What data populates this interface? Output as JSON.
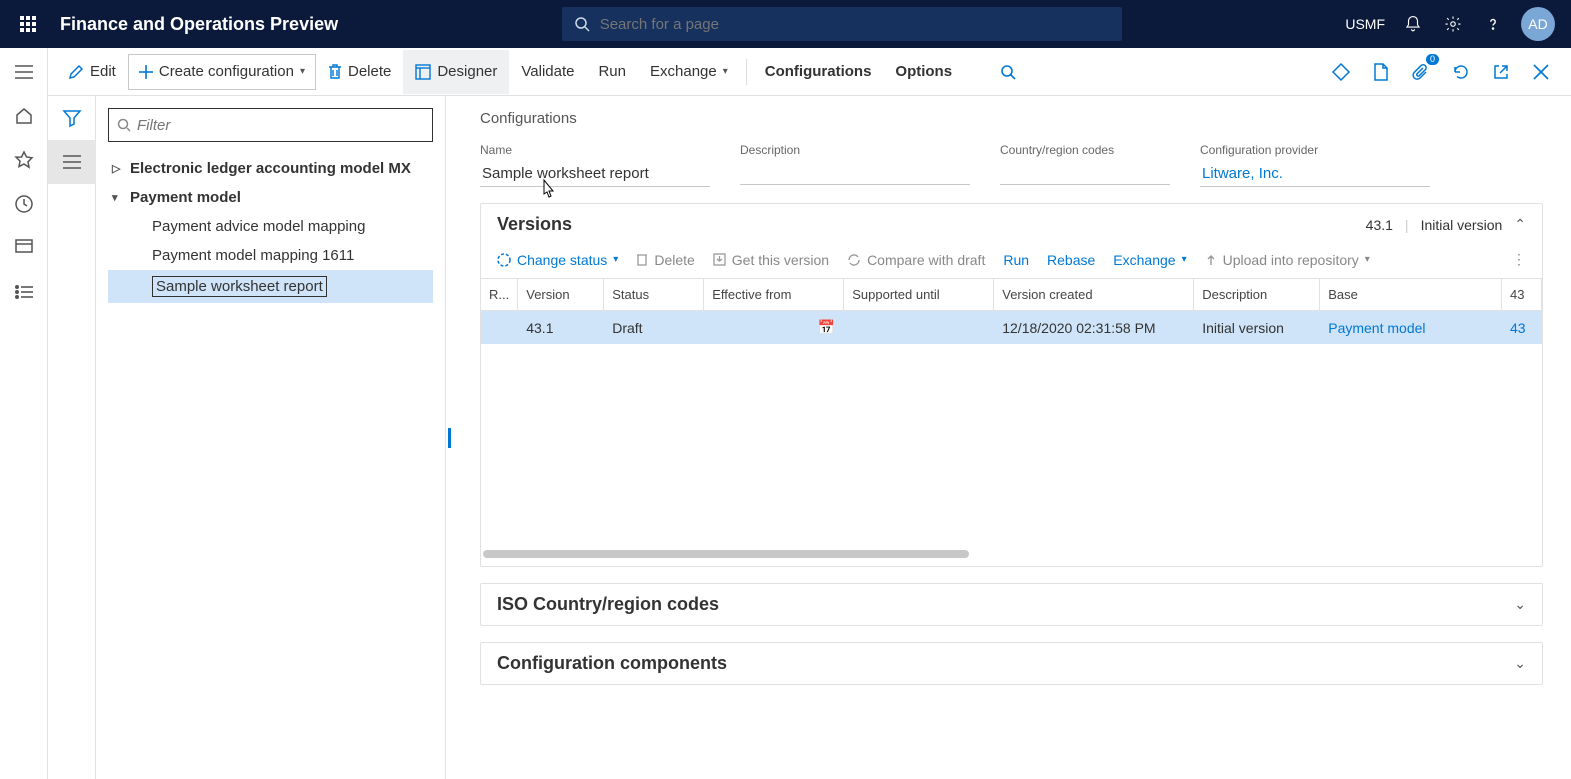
{
  "header": {
    "app_title": "Finance and Operations Preview",
    "search_placeholder": "Search for a page",
    "company": "USMF",
    "avatar_initials": "AD"
  },
  "actionbar": {
    "edit": "Edit",
    "create": "Create configuration",
    "delete": "Delete",
    "designer": "Designer",
    "validate": "Validate",
    "run": "Run",
    "exchange": "Exchange",
    "configurations": "Configurations",
    "options": "Options",
    "attachments_badge": "0"
  },
  "tree": {
    "filter_placeholder": "Filter",
    "items": [
      {
        "label": "Electronic ledger accounting model MX"
      },
      {
        "label": "Payment model"
      },
      {
        "label": "Payment advice model mapping"
      },
      {
        "label": "Payment model mapping 1611"
      },
      {
        "label": "Sample worksheet report"
      }
    ]
  },
  "details": {
    "breadcrumb": "Configurations",
    "fields": {
      "name_label": "Name",
      "name_value": "Sample worksheet report",
      "description_label": "Description",
      "description_value": "",
      "country_label": "Country/region codes",
      "country_value": "",
      "provider_label": "Configuration provider",
      "provider_value": "Litware, Inc."
    },
    "versions": {
      "title": "Versions",
      "meta_version": "43.1",
      "meta_desc": "Initial version",
      "toolbar": {
        "change_status": "Change status",
        "delete": "Delete",
        "get_version": "Get this version",
        "compare": "Compare with draft",
        "run": "Run",
        "rebase": "Rebase",
        "exchange": "Exchange",
        "upload": "Upload into repository"
      },
      "columns": {
        "r": "R...",
        "version": "Version",
        "status": "Status",
        "effective": "Effective from",
        "supported": "Supported until",
        "created": "Version created",
        "description": "Description",
        "base": "Base",
        "basever": "43"
      },
      "row": {
        "version": "43.1",
        "status": "Draft",
        "effective": "",
        "supported": "",
        "created": "12/18/2020 02:31:58 PM",
        "description": "Initial version",
        "base": "Payment model",
        "basever": "43"
      }
    },
    "iso_section": "ISO Country/region codes",
    "components_section": "Configuration components"
  }
}
